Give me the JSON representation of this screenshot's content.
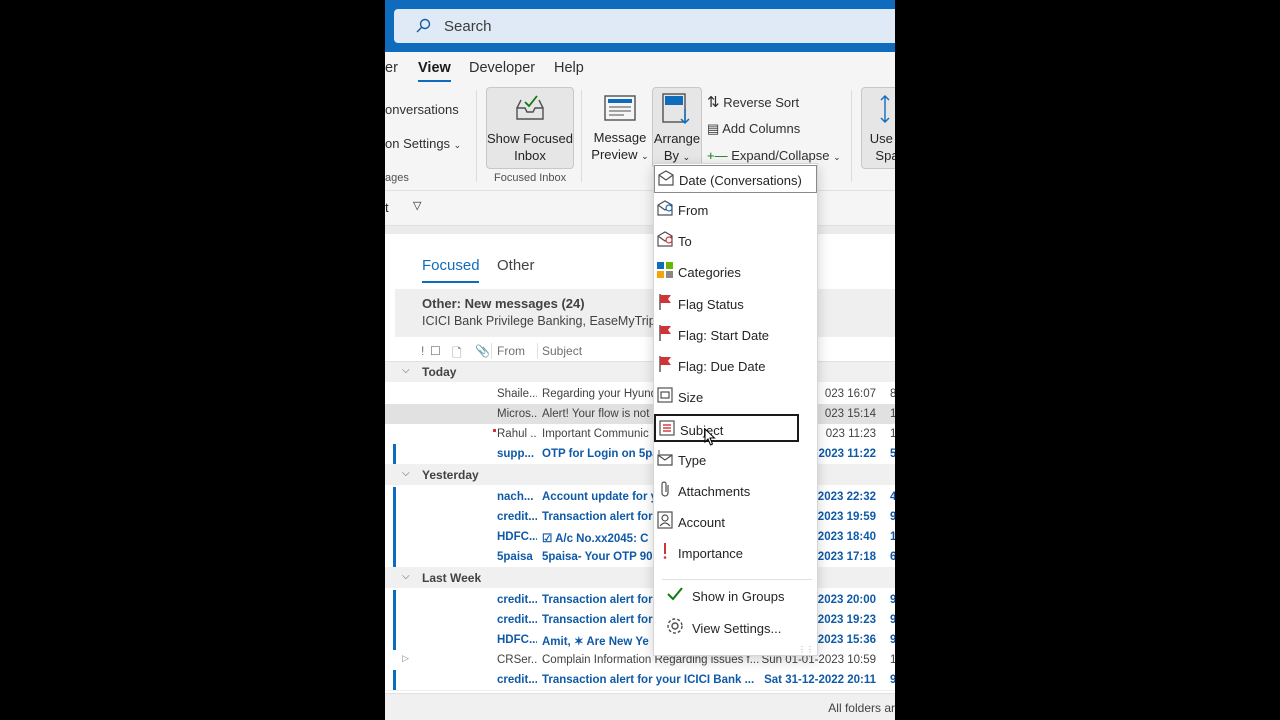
{
  "search": {
    "placeholder": "Search"
  },
  "ribbon": {
    "tabs": [
      "er",
      "View",
      "Developer",
      "Help"
    ],
    "conversations_label": "onversations",
    "conv_settings_label": "on Settings",
    "messages_group": "ages",
    "show_focused_inbox": [
      "Show Focused",
      "Inbox"
    ],
    "focused_inbox_group": "Focused Inbox",
    "message_preview": [
      "Message",
      "Preview"
    ],
    "arrange_by": [
      "Arrange",
      "By"
    ],
    "reverse_sort": "Reverse Sort",
    "add_columns": "Add Columns",
    "expand_collapse": "Expand/Collapse",
    "use_t": [
      "Use T",
      "Spa"
    ]
  },
  "filterbar": {
    "label": "t"
  },
  "pivot": {
    "focused": "Focused",
    "other": "Other"
  },
  "notice": {
    "title": "Other: New messages (24)",
    "senders": "ICICI Bank Privilege Banking, EaseMyTrip,"
  },
  "list_header": {
    "from": "From",
    "subject": "Subject"
  },
  "groups": {
    "today": "Today",
    "yesterday": "Yesterday",
    "last_week": "Last Week"
  },
  "rows": [
    {
      "from": "Shaile...",
      "subject": "Regarding your Hyund",
      "date": "023 16:07",
      "size": "8"
    },
    {
      "from": "Micros...",
      "subject": "Alert! Your flow is not",
      "date": "023 15:14",
      "size": "1"
    },
    {
      "from": "Rahul ...",
      "subject": "Important Communic",
      "date": "023 11:23",
      "size": "1"
    },
    {
      "from": "supp...",
      "subject": "OTP for Login on 5pa",
      "date": "2023 11:22",
      "size": "5"
    },
    {
      "from": "nach...",
      "subject": "Account update for y",
      "date": "-2023 22:32",
      "size": "4"
    },
    {
      "from": "credit...",
      "subject": "Transaction alert for",
      "date": "-2023 19:59",
      "size": "9"
    },
    {
      "from": "HDFC...",
      "subject": "☑ A/c No.xx2045: C",
      "date": "-2023 18:40",
      "size": "1"
    },
    {
      "from": "5paisa",
      "subject": "5paisa- Your OTP 90",
      "date": "-2023 17:18",
      "size": "6"
    },
    {
      "from": "credit...",
      "subject": "Transaction alert for",
      "date": "-2023 20:00",
      "size": "9"
    },
    {
      "from": "credit...",
      "subject": "Transaction alert for",
      "date": "-2023 19:23",
      "size": "9"
    },
    {
      "from": "HDFC...",
      "subject": "Amit, ✶ Are New Ye",
      "date": "-2023 15:36",
      "size": "9"
    },
    {
      "from": "CRSer...",
      "subject": "Complain Information Regarding issues f...",
      "date": "Sun 01-01-2023 10:59",
      "size": "1"
    },
    {
      "from": "credit...",
      "subject": "Transaction alert for your ICICI Bank ...",
      "date": "Sat 31-12-2022 20:11",
      "size": "9"
    }
  ],
  "status": {
    "text": "All folders ar"
  },
  "menu": {
    "items": [
      {
        "label": "Date (Conversations)",
        "icon": "date-envelope-icon"
      },
      {
        "label": "From",
        "icon": "from-envelope-icon"
      },
      {
        "label": "To",
        "icon": "to-envelope-icon"
      },
      {
        "label": "Categories",
        "icon": "categories-icon"
      },
      {
        "label": "Flag Status",
        "icon": "flag-icon"
      },
      {
        "label": "Flag: Start Date",
        "icon": "flag-icon"
      },
      {
        "label": "Flag: Due Date",
        "icon": "flag-icon"
      },
      {
        "label": "Size",
        "icon": "size-icon"
      },
      {
        "label": "Subject",
        "icon": "subject-icon"
      },
      {
        "label": "Type",
        "icon": "type-envelope-icon"
      },
      {
        "label": "Attachments",
        "icon": "paperclip-icon"
      },
      {
        "label": "Account",
        "icon": "account-icon"
      },
      {
        "label": "Importance",
        "icon": "importance-icon"
      }
    ],
    "show_in_groups": "Show in Groups",
    "view_settings": "View Settings..."
  },
  "colors": {
    "accent": "#0f6cbd",
    "flag": "#d13438",
    "check": "#107c10"
  }
}
